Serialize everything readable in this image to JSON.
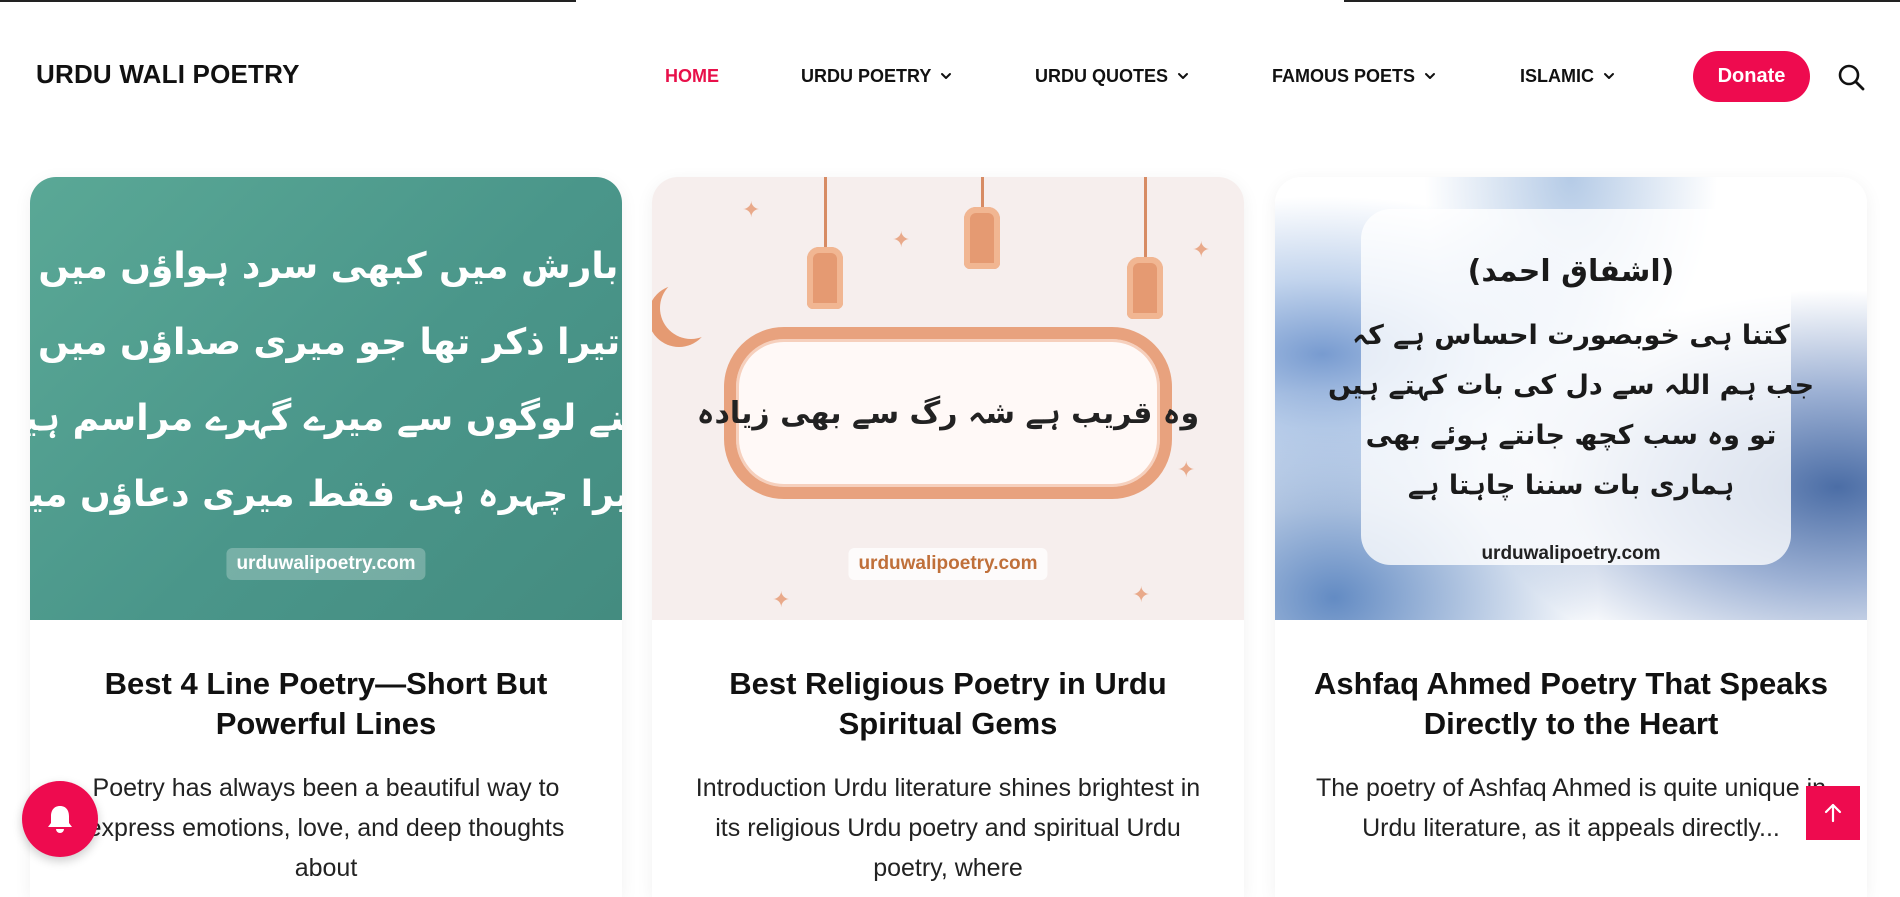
{
  "site": {
    "logo": "URDU WALI POETRY"
  },
  "nav": {
    "items": [
      {
        "label": "HOME",
        "active": true,
        "dropdown": false
      },
      {
        "label": "URDU POETRY",
        "active": false,
        "dropdown": true
      },
      {
        "label": "URDU QUOTES",
        "active": false,
        "dropdown": true
      },
      {
        "label": "FAMOUS POETS",
        "active": false,
        "dropdown": true
      },
      {
        "label": "ISLAMIC",
        "active": false,
        "dropdown": true
      }
    ],
    "donate_label": "Donate",
    "search_icon": "search-icon"
  },
  "colors": {
    "accent": "#ee0b4f",
    "text": "#111111"
  },
  "cards": [
    {
      "image": {
        "lines": [
          "تیز بارش میں کبھی سرد ہواؤں میں رہا",
          "اک تیرا ذکر تھا جو میری صداؤں میں رہا",
          "کتنے لوگوں سے میرے گہرے مراسم ہیں",
          "مگر تیرا چہرہ ہی فقط میری دعاؤں میں رہا"
        ],
        "watermark": "urduwalipoetry.com"
      },
      "title": "Best 4 Line Poetry—Short But Powerful Lines",
      "excerpt": "Poetry has always been a beautiful way to express emotions, love, and deep thoughts about"
    },
    {
      "image": {
        "line": "وہ قریب ہے شہ رگ سے بھی زیادہ",
        "watermark": "urduwalipoetry.com"
      },
      "title": "Best Religious Poetry in Urdu Spiritual Gems",
      "excerpt": "Introduction Urdu literature shines brightest in its religious Urdu poetry and spiritual Urdu poetry, where"
    },
    {
      "image": {
        "heading": "(اشفاق احمد)",
        "lines": [
          "کتنا ہی خوبصورت احساس ہے کہ",
          "جب ہم اللہ سے دل کی بات کہتے ہیں",
          "تو وہ سب کچھ جانتے ہوئے بھی",
          "ہماری بات سننا چاہتا ہے"
        ],
        "watermark": "urduwalipoetry.com"
      },
      "title": "Ashfaq Ahmed Poetry That Speaks Directly to the Heart",
      "excerpt": "The poetry of Ashfaq Ahmed is quite unique in Urdu literature, as it appeals directly..."
    }
  ],
  "floating": {
    "bell_icon": "bell-icon",
    "to_top_icon": "arrow-up-icon"
  }
}
